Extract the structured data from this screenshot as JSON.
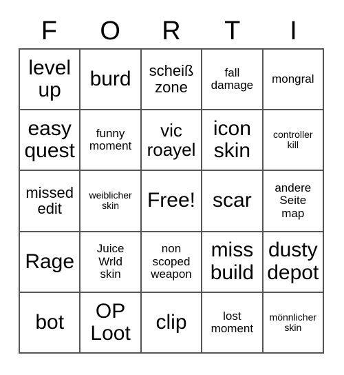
{
  "card": {
    "title_letters": [
      "F",
      "O",
      "R",
      "T",
      "I"
    ],
    "grid_columns": 5,
    "grid_rows": 5,
    "border_color": "#555555",
    "background_color": "#ffffff",
    "text_color": "#000000",
    "cells": [
      {
        "text": "level\nup",
        "size": "s-xl"
      },
      {
        "text": "burd",
        "size": "s-xl"
      },
      {
        "text": "scheiß\nzone",
        "size": "s-md"
      },
      {
        "text": "fall\ndamage",
        "size": "s-sm"
      },
      {
        "text": "mongral",
        "size": "s-sm"
      },
      {
        "text": "easy\nquest",
        "size": "s-xl"
      },
      {
        "text": "funny\nmoment",
        "size": "s-sm"
      },
      {
        "text": "vic\nroayel",
        "size": "s-lg"
      },
      {
        "text": "icon\nskin",
        "size": "s-xl"
      },
      {
        "text": "controller\nkill",
        "size": "s-xs"
      },
      {
        "text": "missed\nedit",
        "size": "s-md"
      },
      {
        "text": "weiblicher\nskin",
        "size": "s-xs"
      },
      {
        "text": "Free!",
        "size": "s-xl"
      },
      {
        "text": "scar",
        "size": "s-xl"
      },
      {
        "text": "andere\nSeite\nmap",
        "size": "s-sm"
      },
      {
        "text": "Rage",
        "size": "s-xl"
      },
      {
        "text": "Juice\nWrld\nskin",
        "size": "s-sm"
      },
      {
        "text": "non\nscoped\nweapon",
        "size": "s-sm"
      },
      {
        "text": "miss\nbuild",
        "size": "s-xl"
      },
      {
        "text": "dusty\ndepot",
        "size": "s-xl"
      },
      {
        "text": "bot",
        "size": "s-xl"
      },
      {
        "text": "OP\nLoot",
        "size": "s-xl"
      },
      {
        "text": "clip",
        "size": "s-xl"
      },
      {
        "text": "lost\nmoment",
        "size": "s-sm"
      },
      {
        "text": "mönnlicher\nskin",
        "size": "s-xs"
      }
    ]
  }
}
